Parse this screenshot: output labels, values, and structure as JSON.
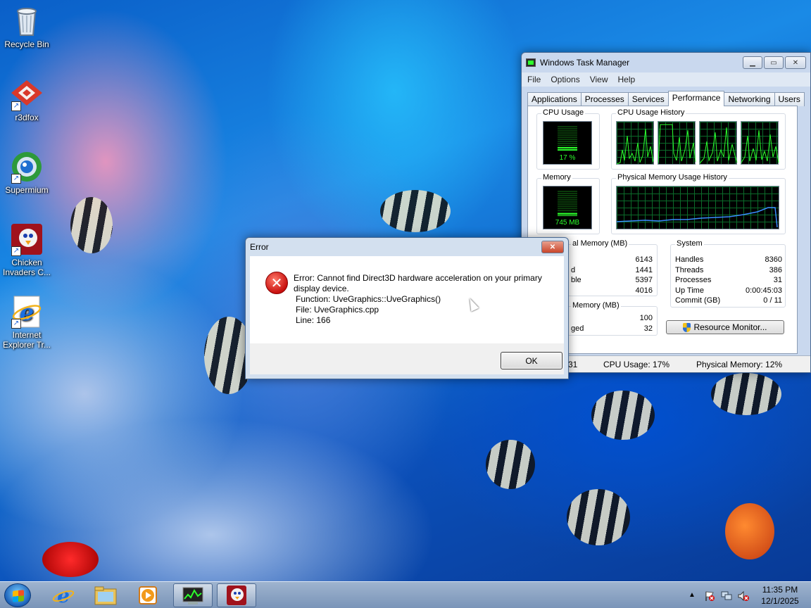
{
  "desktop": {
    "icons": [
      {
        "label": "Recycle Bin",
        "icon": "recycle-bin-icon"
      },
      {
        "label": "r3dfox",
        "icon": "r3dfox-icon"
      },
      {
        "label": "Supermium",
        "icon": "supermium-icon"
      },
      {
        "label": "Chicken Invaders C...",
        "icon": "chicken-invaders-icon"
      },
      {
        "label": "Internet Explorer Tr...",
        "icon": "internet-explorer-icon"
      }
    ]
  },
  "task_manager": {
    "title": "Windows Task Manager",
    "menu": [
      "File",
      "Options",
      "View",
      "Help"
    ],
    "tabs": [
      "Applications",
      "Processes",
      "Services",
      "Performance",
      "Networking",
      "Users"
    ],
    "active_tab": "Performance",
    "cpu_usage": {
      "title": "CPU Usage",
      "value": "17 %",
      "fraction": 0.17
    },
    "cpu_history": {
      "title": "CPU Usage History"
    },
    "memory": {
      "title": "Memory",
      "value": "745 MB",
      "fraction": 0.12
    },
    "physical_memory_history": {
      "title": "Physical Memory Usage History"
    },
    "physical_memory": {
      "title": "al Memory (MB)",
      "rows": [
        {
          "label": "",
          "value": "6143"
        },
        {
          "label": "d",
          "value": "1441"
        },
        {
          "label": "ble",
          "value": "5397"
        },
        {
          "label": "",
          "value": "4016"
        }
      ]
    },
    "kernel_memory": {
      "title": "Memory (MB)",
      "rows": [
        {
          "label": "",
          "value": "100"
        },
        {
          "label": "ged",
          "value": "32"
        }
      ]
    },
    "system": {
      "title": "System",
      "rows": [
        {
          "label": "Handles",
          "value": "8360"
        },
        {
          "label": "Threads",
          "value": "386"
        },
        {
          "label": "Processes",
          "value": "31"
        },
        {
          "label": "Up Time",
          "value": "0:00:45:03"
        },
        {
          "label": "Commit (GB)",
          "value": "0 / 11"
        }
      ]
    },
    "resource_monitor_button": "Resource Monitor...",
    "status": {
      "processes": "31",
      "cpu": "CPU Usage: 17%",
      "memory": "Physical Memory: 12%"
    }
  },
  "error_dialog": {
    "title": "Error",
    "message_line1": "Error: Cannot find Direct3D hardware acceleration on your primary",
    "message_line2": "display device.",
    "function_line": "Function: UveGraphics::UveGraphics()",
    "file_line": "File: UveGraphics.cpp",
    "line_line": "Line: 166",
    "ok_label": "OK",
    "close_glyph": "✕"
  },
  "taskbar": {
    "items": [
      "start-button",
      "internet-explorer",
      "windows-explorer",
      "media-player",
      "task-manager",
      "chicken-invaders"
    ],
    "time": "11:35 PM",
    "date": "12/1/2025"
  }
}
